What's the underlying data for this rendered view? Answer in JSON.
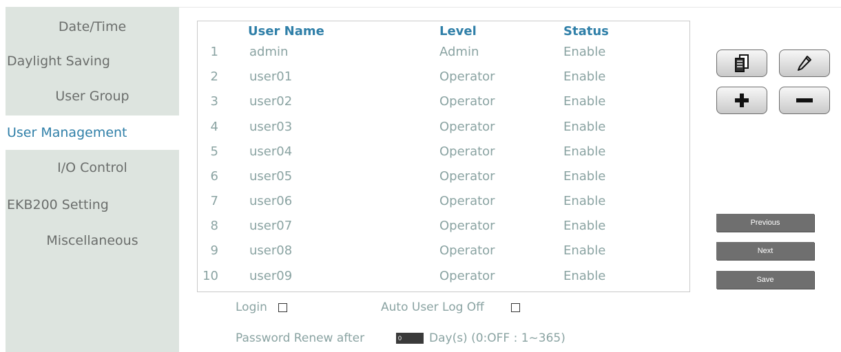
{
  "sidebar": {
    "items": [
      {
        "label": "Date/Time"
      },
      {
        "label": "Daylight Saving"
      },
      {
        "label": "User Group"
      },
      {
        "label": "User Management"
      },
      {
        "label": "I/O Control"
      },
      {
        "label": "EKB200 Setting"
      },
      {
        "label": "Miscellaneous"
      }
    ],
    "active": "User Management"
  },
  "table": {
    "headers": {
      "user_name": "User Name",
      "level": "Level",
      "status": "Status"
    },
    "rows": [
      {
        "num": "1",
        "user": "admin",
        "level": "Admin",
        "status": "Enable"
      },
      {
        "num": "2",
        "user": "user01",
        "level": "Operator",
        "status": "Enable"
      },
      {
        "num": "3",
        "user": "user02",
        "level": "Operator",
        "status": "Enable"
      },
      {
        "num": "4",
        "user": "user03",
        "level": "Operator",
        "status": "Enable"
      },
      {
        "num": "5",
        "user": "user04",
        "level": "Operator",
        "status": "Enable"
      },
      {
        "num": "6",
        "user": "user05",
        "level": "Operator",
        "status": "Enable"
      },
      {
        "num": "7",
        "user": "user06",
        "level": "Operator",
        "status": "Enable"
      },
      {
        "num": "8",
        "user": "user07",
        "level": "Operator",
        "status": "Enable"
      },
      {
        "num": "9",
        "user": "user08",
        "level": "Operator",
        "status": "Enable"
      },
      {
        "num": "10",
        "user": "user09",
        "level": "Operator",
        "status": "Enable"
      }
    ]
  },
  "actions": {
    "copy_icon": "copy-document-icon",
    "edit_icon": "pencil-icon",
    "add_icon": "plus-icon",
    "remove_icon": "minus-icon"
  },
  "pager": {
    "previous": "Previous",
    "next": "Next",
    "save": "Save"
  },
  "options": {
    "login_label": "Login",
    "auto_logoff_label": "Auto User Log Off",
    "login_checked": false,
    "auto_logoff_checked": false,
    "password_renew_prefix": "Password Renew after",
    "password_renew_value": "0",
    "password_renew_suffix": "Day(s) (0:OFF : 1~365)"
  },
  "colors": {
    "sidebar_bg": "#dde4df",
    "accent": "#2f7fa8",
    "text_muted": "#8aa3a2",
    "button_dark": "#6f6f6f"
  }
}
